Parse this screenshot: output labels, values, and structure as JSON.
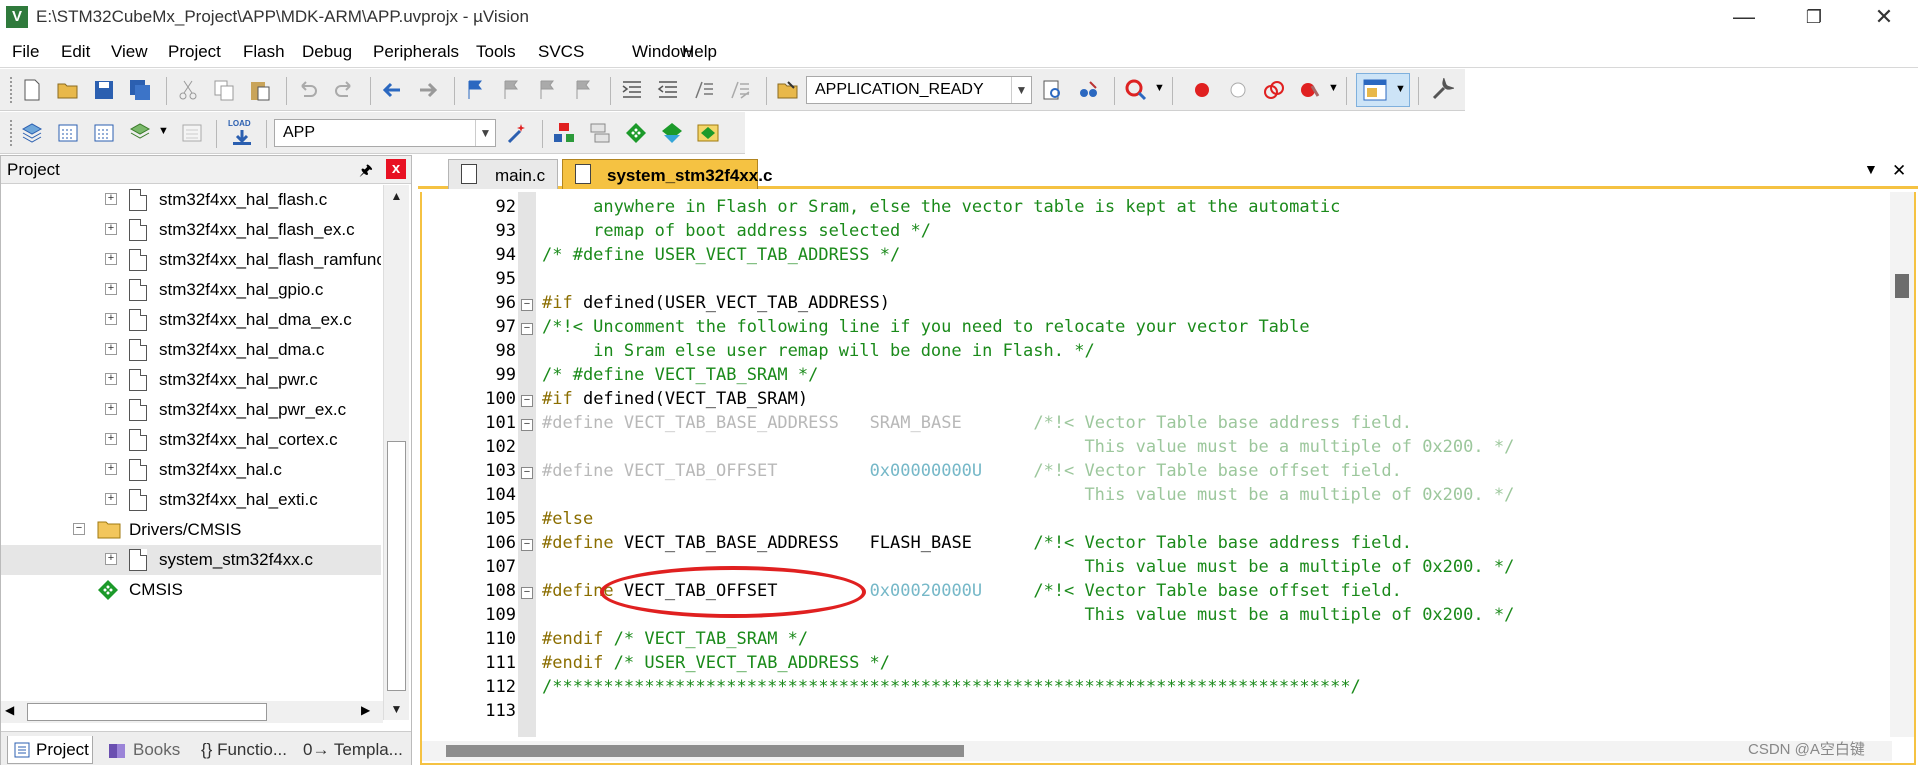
{
  "window": {
    "app_icon_letter": "V",
    "title": "E:\\STM32CubeMx_Project\\APP\\MDK-ARM\\APP.uvprojx - µVision",
    "minimize": "—",
    "maximize": "❐",
    "close": "✕"
  },
  "menu": [
    "File",
    "Edit",
    "View",
    "Project",
    "Flash",
    "Debug",
    "Peripherals",
    "Tools",
    "SVCS",
    "Window",
    "Help"
  ],
  "toolbar": {
    "target_combo": "APPLICATION_READY",
    "project_combo": "APP",
    "load_label": "LOAD"
  },
  "project_panel": {
    "title": "Project",
    "pin": "🖈",
    "close": "x",
    "tree": [
      {
        "label": "stm32f4xx_hal_flash.c",
        "type": "file"
      },
      {
        "label": "stm32f4xx_hal_flash_ex.c",
        "type": "file"
      },
      {
        "label": "stm32f4xx_hal_flash_ramfunc",
        "type": "file"
      },
      {
        "label": "stm32f4xx_hal_gpio.c",
        "type": "file"
      },
      {
        "label": "stm32f4xx_hal_dma_ex.c",
        "type": "file"
      },
      {
        "label": "stm32f4xx_hal_dma.c",
        "type": "file"
      },
      {
        "label": "stm32f4xx_hal_pwr.c",
        "type": "file"
      },
      {
        "label": "stm32f4xx_hal_pwr_ex.c",
        "type": "file"
      },
      {
        "label": "stm32f4xx_hal_cortex.c",
        "type": "file"
      },
      {
        "label": "stm32f4xx_hal.c",
        "type": "file"
      },
      {
        "label": "stm32f4xx_hal_exti.c",
        "type": "file"
      },
      {
        "label": "Drivers/CMSIS",
        "type": "folder"
      },
      {
        "label": "system_stm32f4xx.c",
        "type": "file",
        "selected": true
      },
      {
        "label": "CMSIS",
        "type": "component"
      }
    ],
    "bottom_tabs": [
      "Project",
      "Books",
      "{} Functio...",
      "0→ Templa..."
    ]
  },
  "editor": {
    "tabs": [
      {
        "label": "main.c",
        "active": false
      },
      {
        "label": "system_stm32f4xx.c",
        "active": true
      }
    ],
    "dropdown_arrow": "▼",
    "close": "✕",
    "lines": [
      {
        "n": "92",
        "fold": false,
        "text": "     anywhere in Flash or Sram, else the vector table is kept at the automatic"
      },
      {
        "n": "93",
        "fold": false,
        "text": "     remap of boot address selected */"
      },
      {
        "n": "94",
        "fold": false,
        "text": "/* #define USER_VECT_TAB_ADDRESS */"
      },
      {
        "n": "95",
        "fold": false,
        "text": ""
      },
      {
        "n": "96",
        "fold": true,
        "text": "#if defined(USER_VECT_TAB_ADDRESS)"
      },
      {
        "n": "97",
        "fold": true,
        "text": "/*!< Uncomment the following line if you need to relocate your vector Table"
      },
      {
        "n": "98",
        "fold": false,
        "text": "     in Sram else user remap will be done in Flash. */"
      },
      {
        "n": "99",
        "fold": false,
        "text": "/* #define VECT_TAB_SRAM */"
      },
      {
        "n": "100",
        "fold": true,
        "text": "#if defined(VECT_TAB_SRAM)"
      },
      {
        "n": "101",
        "fold": true,
        "text": "#define VECT_TAB_BASE_ADDRESS   SRAM_BASE       /*!< Vector Table base address field."
      },
      {
        "n": "102",
        "fold": false,
        "text": "                                                     This value must be a multiple of 0x200. */"
      },
      {
        "n": "103",
        "fold": true,
        "text": "#define VECT_TAB_OFFSET         0x00000000U     /*!< Vector Table base offset field."
      },
      {
        "n": "104",
        "fold": false,
        "text": "                                                     This value must be a multiple of 0x200. */"
      },
      {
        "n": "105",
        "fold": false,
        "text": "#else"
      },
      {
        "n": "106",
        "fold": true,
        "text": "#define VECT_TAB_BASE_ADDRESS   FLASH_BASE      /*!< Vector Table base address field."
      },
      {
        "n": "107",
        "fold": false,
        "text": "                                                     This value must be a multiple of 0x200. */"
      },
      {
        "n": "108",
        "fold": true,
        "text": "#define VECT_TAB_OFFSET         0x00020000U     /*!< Vector Table base offset field."
      },
      {
        "n": "109",
        "fold": false,
        "text": "                                                     This value must be a multiple of 0x200. */"
      },
      {
        "n": "110",
        "fold": false,
        "text": "#endif /* VECT_TAB_SRAM */"
      },
      {
        "n": "111",
        "fold": false,
        "text": "#endif /* USER_VECT_TAB_ADDRESS */"
      },
      {
        "n": "112",
        "fold": false,
        "text": "/******************************************************************************/"
      },
      {
        "n": "113",
        "fold": false,
        "text": ""
      }
    ]
  },
  "watermark": "CSDN @A空白键",
  "colors": {
    "accent_tab": "#f5c242",
    "annotation": "#e02020",
    "comment": "#1a8a1a",
    "preprocessor": "#8b6e00"
  }
}
